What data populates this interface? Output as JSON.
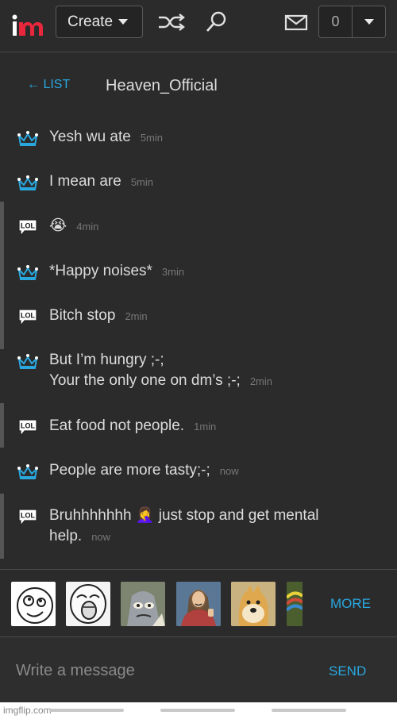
{
  "topbar": {
    "create_label": "Create",
    "notification_count": "0"
  },
  "header": {
    "back_label": "← LIST",
    "chat_title": "Heaven_Official"
  },
  "messages": [
    {
      "author_badge": "crown",
      "lines": [
        "Yesh wu ate"
      ],
      "time": "5min"
    },
    {
      "author_badge": "crown",
      "lines": [
        "I mean are"
      ],
      "time": "5min"
    },
    {
      "author_badge": "lol",
      "lines": [
        "😭"
      ],
      "time": "4min"
    },
    {
      "author_badge": "crown",
      "lines": [
        "*Happy noises*"
      ],
      "time": "3min"
    },
    {
      "author_badge": "lol",
      "lines": [
        "Bitch stop"
      ],
      "time": "2min"
    },
    {
      "author_badge": "crown",
      "lines": [
        "But I’m hungry ;-;",
        "Your the only one on dm’s ;-;"
      ],
      "time": "2min"
    },
    {
      "author_badge": "lol",
      "lines": [
        "Eat food not people."
      ],
      "time": "1min"
    },
    {
      "author_badge": "crown",
      "lines": [
        "People are more tasty;-;"
      ],
      "time": "now"
    },
    {
      "author_badge": "lol",
      "lines": [
        "Bruhhhhhhh 🤦‍♀️ just stop and get mental",
        "help."
      ],
      "time": "now"
    }
  ],
  "badges": {
    "lol_text": "LOL",
    "crown_color": "#29a8e0"
  },
  "memes": {
    "more_label": "MORE"
  },
  "composer": {
    "placeholder": "Write a message",
    "send_label": "SEND"
  },
  "footer": {
    "brand": "imgflip.com"
  },
  "colors": {
    "accent": "#29a8e0",
    "logo_red": "#e8273d",
    "background": "#2b2b2b"
  }
}
